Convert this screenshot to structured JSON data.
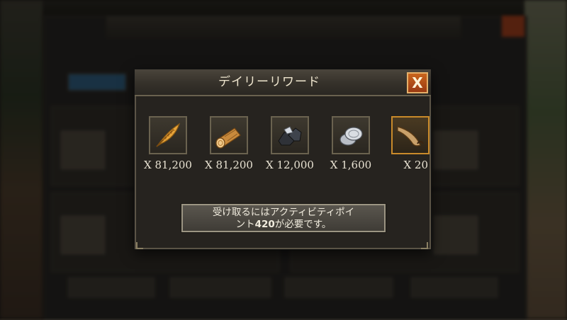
{
  "dialog": {
    "title": "デイリーリワード",
    "close_label": "X"
  },
  "rewards": [
    {
      "icon": "feather-icon",
      "quantity": "X 81,200"
    },
    {
      "icon": "wood-log-icon",
      "quantity": "X 81,200"
    },
    {
      "icon": "iron-ore-icon",
      "quantity": "X 12,000"
    },
    {
      "icon": "silver-coins-icon",
      "quantity": "X 1,600"
    },
    {
      "icon": "horn-icon",
      "quantity": "X 20"
    }
  ],
  "requirement": {
    "text_before": "受け取るにはアクティビティポイ",
    "text_line2_prefix": "ント",
    "points": "420",
    "text_after": "が必要です。"
  },
  "colors": {
    "accent_close": "#c9651d",
    "dialog_bg": "#26231f",
    "text_light": "#efe6cf"
  }
}
